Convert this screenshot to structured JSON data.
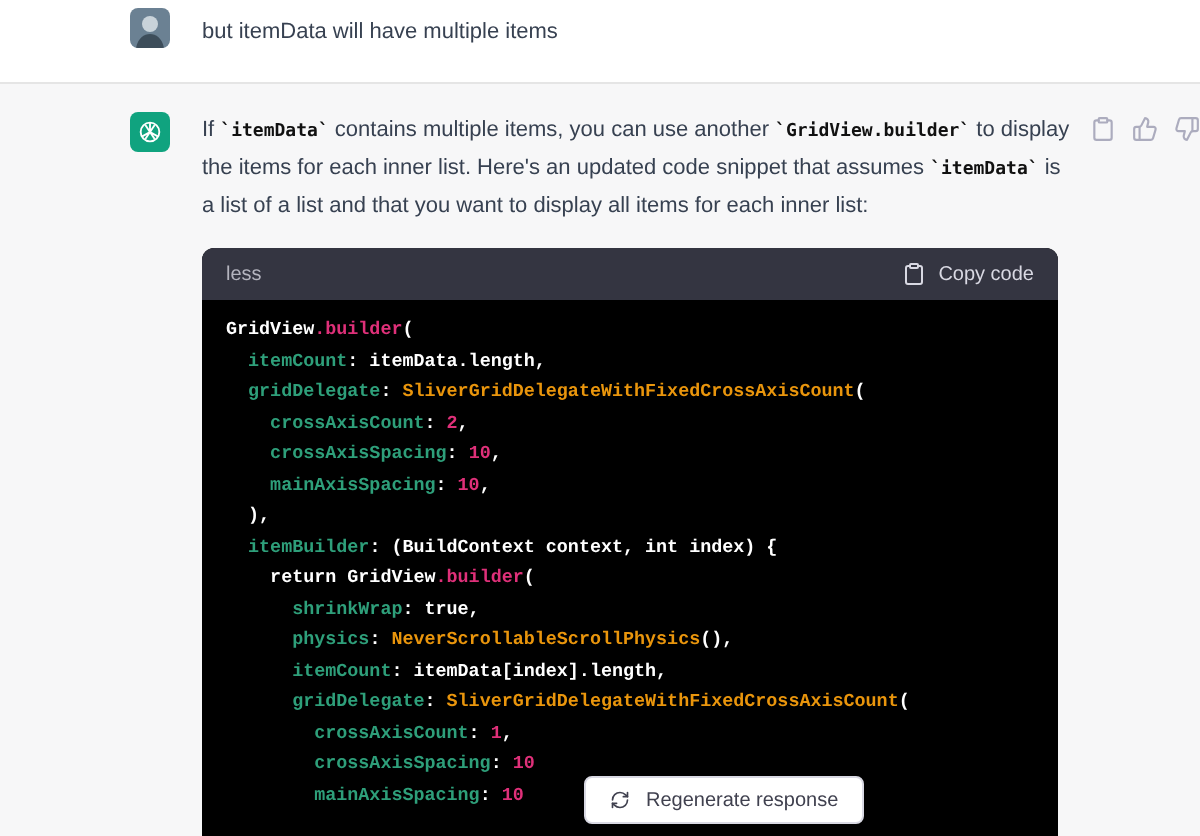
{
  "user_message": {
    "text": "but itemData will have multiple items"
  },
  "assistant_message": {
    "paragraph": [
      {
        "kind": "text",
        "text": "If "
      },
      {
        "kind": "code",
        "text": "`itemData`"
      },
      {
        "kind": "text",
        "text": " contains multiple items, you can use another "
      },
      {
        "kind": "code",
        "text": "`GridView.builder`"
      },
      {
        "kind": "text",
        "text": " to display the items for each inner list. Here's an updated code snippet that assumes "
      },
      {
        "kind": "code",
        "text": "`itemData`"
      },
      {
        "kind": "text",
        "text": " is a list of a list and that you want to display all items for each inner list:"
      }
    ],
    "code_block": {
      "language": "less",
      "copy_label": "Copy code",
      "lines": [
        [
          {
            "kind": "plain",
            "text": "GridView"
          },
          {
            "kind": "method",
            "text": ".builder"
          },
          {
            "kind": "plain",
            "text": "("
          }
        ],
        [
          {
            "kind": "prop",
            "text": "  itemCount"
          },
          {
            "kind": "plain",
            "text": ": itemData.length,"
          }
        ],
        [
          {
            "kind": "prop",
            "text": "  gridDelegate"
          },
          {
            "kind": "plain",
            "text": ": "
          },
          {
            "kind": "type",
            "text": "SliverGridDelegateWithFixedCrossAxisCount"
          },
          {
            "kind": "plain",
            "text": "("
          }
        ],
        [
          {
            "kind": "prop",
            "text": "    crossAxisCount"
          },
          {
            "kind": "plain",
            "text": ": "
          },
          {
            "kind": "number",
            "text": "2"
          },
          {
            "kind": "plain",
            "text": ","
          }
        ],
        [
          {
            "kind": "prop",
            "text": "    crossAxisSpacing"
          },
          {
            "kind": "plain",
            "text": ": "
          },
          {
            "kind": "number",
            "text": "10"
          },
          {
            "kind": "plain",
            "text": ","
          }
        ],
        [
          {
            "kind": "prop",
            "text": "    mainAxisSpacing"
          },
          {
            "kind": "plain",
            "text": ": "
          },
          {
            "kind": "number",
            "text": "10"
          },
          {
            "kind": "plain",
            "text": ","
          }
        ],
        [
          {
            "kind": "plain",
            "text": "  ),"
          }
        ],
        [
          {
            "kind": "prop",
            "text": "  itemBuilder"
          },
          {
            "kind": "plain",
            "text": ": (BuildContext context, int index) {"
          }
        ],
        [
          {
            "kind": "plain",
            "text": "    return GridView"
          },
          {
            "kind": "method",
            "text": ".builder"
          },
          {
            "kind": "plain",
            "text": "("
          }
        ],
        [
          {
            "kind": "prop",
            "text": "      shrinkWrap"
          },
          {
            "kind": "plain",
            "text": ": true,"
          }
        ],
        [
          {
            "kind": "prop",
            "text": "      physics"
          },
          {
            "kind": "plain",
            "text": ": "
          },
          {
            "kind": "type",
            "text": "NeverScrollableScrollPhysics"
          },
          {
            "kind": "plain",
            "text": "(),"
          }
        ],
        [
          {
            "kind": "prop",
            "text": "      itemCount"
          },
          {
            "kind": "plain",
            "text": ": itemData[index].length,"
          }
        ],
        [
          {
            "kind": "prop",
            "text": "      gridDelegate"
          },
          {
            "kind": "plain",
            "text": ": "
          },
          {
            "kind": "type",
            "text": "SliverGridDelegateWithFixedCrossAxisCount"
          },
          {
            "kind": "plain",
            "text": "("
          }
        ],
        [
          {
            "kind": "prop",
            "text": "        crossAxisCount"
          },
          {
            "kind": "plain",
            "text": ": "
          },
          {
            "kind": "number",
            "text": "1"
          },
          {
            "kind": "plain",
            "text": ","
          }
        ],
        [
          {
            "kind": "prop",
            "text": "        crossAxisSpacing"
          },
          {
            "kind": "plain",
            "text": ": "
          },
          {
            "kind": "number",
            "text": "10"
          }
        ],
        [
          {
            "kind": "prop",
            "text": "        mainAxisSpacing"
          },
          {
            "kind": "plain",
            "text": ": "
          },
          {
            "kind": "number",
            "text": "10"
          }
        ]
      ]
    }
  },
  "regenerate_button": {
    "label": "Regenerate response"
  }
}
